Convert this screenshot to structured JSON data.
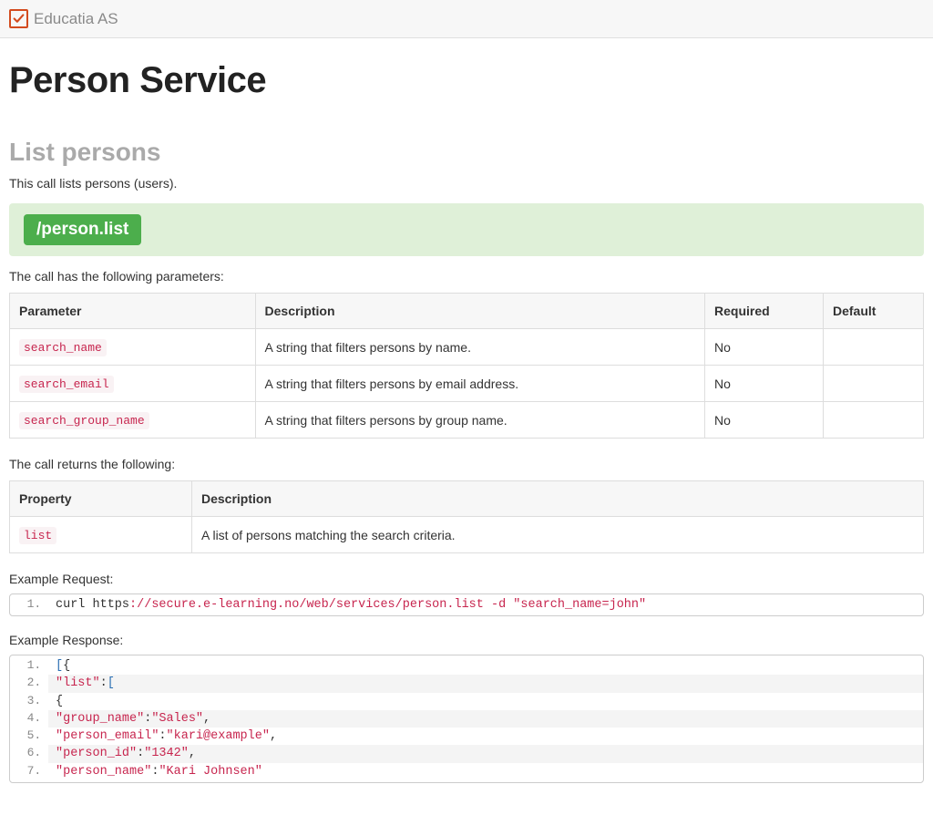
{
  "header": {
    "brand": "Educatia AS"
  },
  "page": {
    "title": "Person Service"
  },
  "section": {
    "title": "List persons",
    "intro": "This call lists persons (users).",
    "endpoint": "/person.list",
    "params_intro": "The call has the following parameters:",
    "returns_intro": "The call returns the following:",
    "example_request_label": "Example Request:",
    "example_response_label": "Example Response:"
  },
  "params_table": {
    "headers": {
      "param": "Parameter",
      "desc": "Description",
      "req": "Required",
      "def": "Default"
    },
    "rows": [
      {
        "param": "search_name",
        "desc": "A string that filters persons by name.",
        "req": "No",
        "def": ""
      },
      {
        "param": "search_email",
        "desc": "A string that filters persons by email address.",
        "req": "No",
        "def": ""
      },
      {
        "param": "search_group_name",
        "desc": "A string that filters persons by group name.",
        "req": "No",
        "def": ""
      }
    ]
  },
  "returns_table": {
    "headers": {
      "prop": "Property",
      "desc": "Description"
    },
    "rows": [
      {
        "prop": "list",
        "desc": "A list of persons matching the search criteria."
      }
    ]
  },
  "example_request": {
    "prefix": "curl https",
    "url": "://secure.e-learning.no/web/services/person.list -d \"search_name=john\""
  },
  "example_response": {
    "l1_a": "[",
    "l1_b": "{",
    "l2_key": "\"list\"",
    "l2_colon": ":",
    "l2_br": "[",
    "l3": "{",
    "l4_key": "\"group_name\"",
    "l4_val": "\"Sales\"",
    "l5_key": "\"person_email\"",
    "l5_val": "\"kari@example\"",
    "l6_key": "\"person_id\"",
    "l6_val": "\"1342\"",
    "l7_key": "\"person_name\"",
    "l7_val": "\"Kari Johnsen\""
  }
}
